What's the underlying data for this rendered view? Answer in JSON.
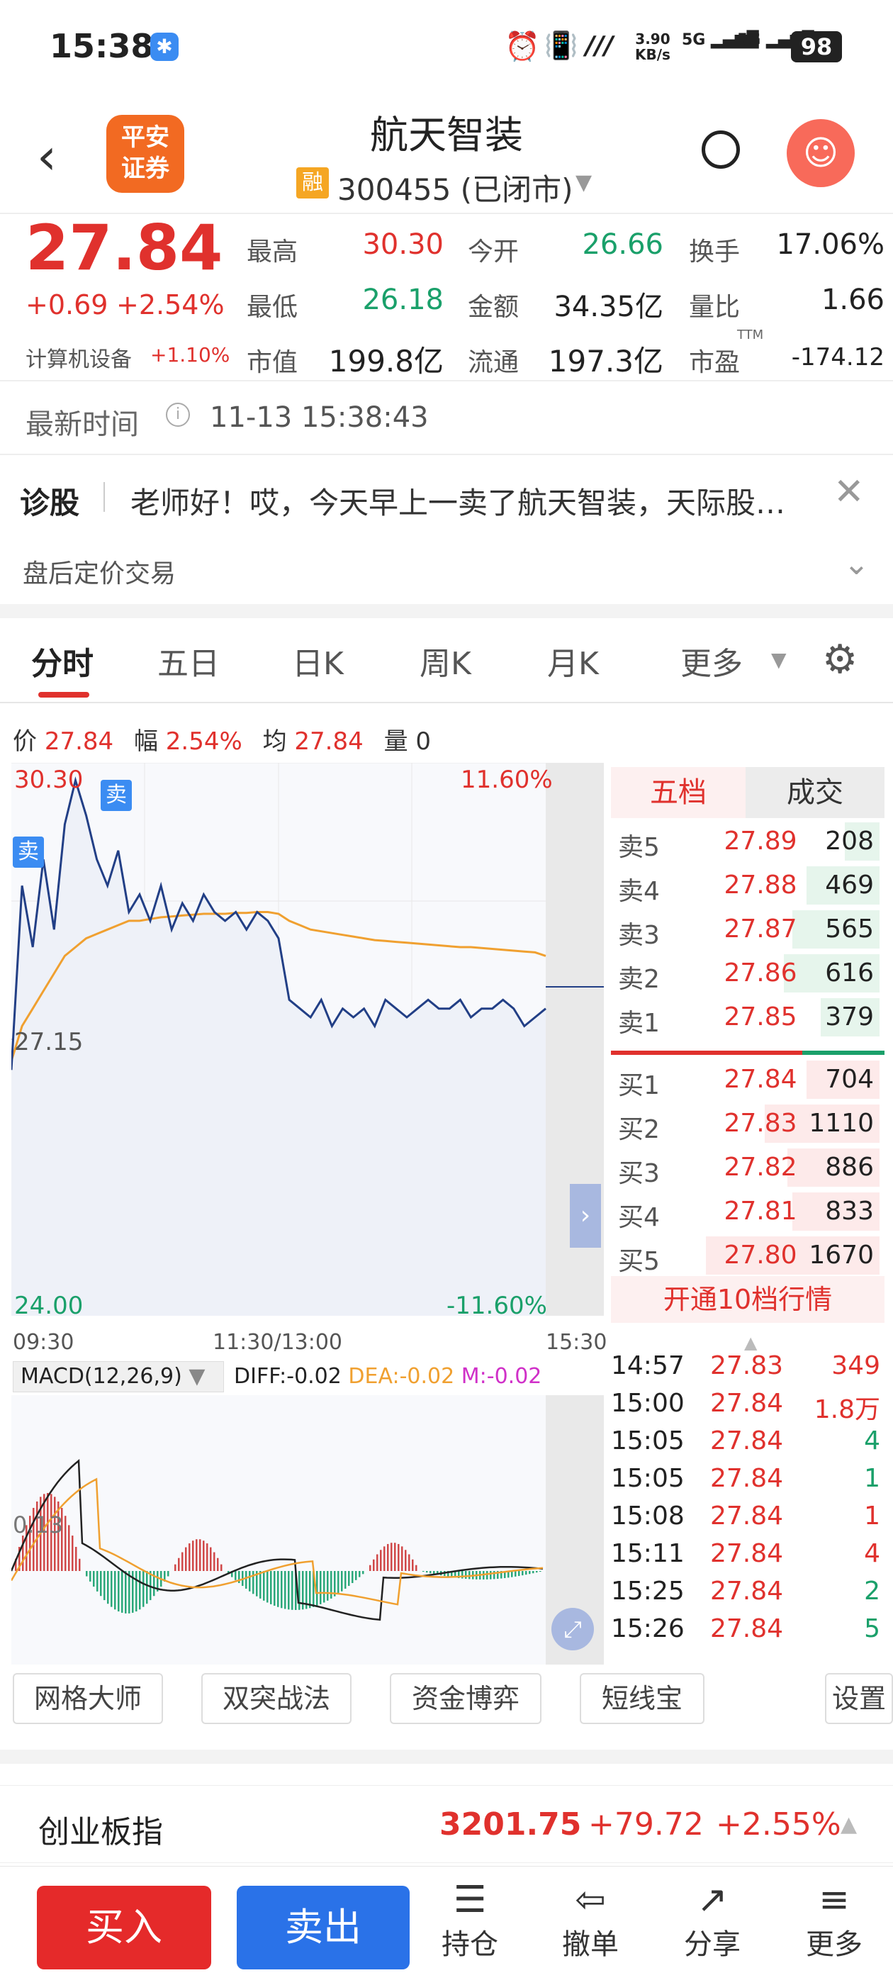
{
  "status_bar": {
    "time": "15:38",
    "net_speed_top": "3.90",
    "net_speed_bottom": "KB/s",
    "sig1": "5G",
    "sig2": "5G",
    "battery": "98"
  },
  "header": {
    "stock_name": "航天智装",
    "margin_badge": "融",
    "code_status": "300455 (已闭市)",
    "broker_logo": "平安\n证券"
  },
  "quote": {
    "price": "27.84",
    "change": "+0.69",
    "change_pct": "+2.54%",
    "industry": "计算机设备",
    "industry_pct": "+1.10%",
    "high_label": "最高",
    "high": "30.30",
    "open_label": "今开",
    "open": "26.66",
    "turnover_label": "换手",
    "turnover": "17.06%",
    "low_label": "最低",
    "low": "26.18",
    "amount_label": "金额",
    "amount": "34.35亿",
    "vol_ratio_label": "量比",
    "vol_ratio": "1.66",
    "mktcap_label": "市值",
    "mktcap": "199.8亿",
    "float_label": "流通",
    "float": "197.3亿",
    "pe_label": "市盈",
    "pe_sup": "TTM",
    "pe": "-174.12"
  },
  "latest_time": {
    "label": "最新时间",
    "value": "11-13 15:38:43"
  },
  "diagnose": {
    "label": "诊股",
    "text": "老师好！哎，今天早上一卖了航天智装，天际股…"
  },
  "after_hours": {
    "label": "盘后定价交易"
  },
  "tabs": [
    "分时",
    "五日",
    "日K",
    "周K",
    "月K",
    "更多"
  ],
  "info_line": {
    "price_label": "价",
    "price": "27.84",
    "amp_label": "幅",
    "amp": "2.54%",
    "avg_label": "均",
    "avg": "27.84",
    "vol_label": "量",
    "vol": "0"
  },
  "chart_labels": {
    "top_left": "30.30",
    "top_right": "11.60%",
    "mid": "27.15",
    "bottom_left": "24.00",
    "bottom_right": "-11.60%",
    "t_start": "09:30",
    "t_mid": "11:30/13:00",
    "t_end": "15:30",
    "sell_tag": "卖",
    "macd_mid": "0.13"
  },
  "macd": {
    "label": "MACD(12,26,9)",
    "diff": "DIFF:-0.02",
    "dea": "DEA:-0.02",
    "m": "M:-0.02"
  },
  "orderbook_tabs": {
    "active": "五档",
    "inactive": "成交"
  },
  "asks": [
    {
      "label": "卖5",
      "price": "27.89",
      "vol": "208",
      "bar": 0.2
    },
    {
      "label": "卖4",
      "price": "27.88",
      "vol": "469",
      "bar": 0.42
    },
    {
      "label": "卖3",
      "price": "27.87",
      "vol": "565",
      "bar": 0.5
    },
    {
      "label": "卖2",
      "price": "27.86",
      "vol": "616",
      "bar": 0.55
    },
    {
      "label": "卖1",
      "price": "27.85",
      "vol": "379",
      "bar": 0.34
    }
  ],
  "bids": [
    {
      "label": "买1",
      "price": "27.84",
      "vol": "704",
      "bar": 0.42
    },
    {
      "label": "买2",
      "price": "27.83",
      "vol": "1110",
      "bar": 0.66
    },
    {
      "label": "买3",
      "price": "27.82",
      "vol": "886",
      "bar": 0.53
    },
    {
      "label": "买4",
      "price": "27.81",
      "vol": "833",
      "bar": 0.5
    },
    {
      "label": "买5",
      "price": "27.80",
      "vol": "1670",
      "bar": 1.0
    }
  ],
  "open_l2": "开通10档行情",
  "trades": [
    {
      "time": "14:57",
      "price": "27.83",
      "vol": "349",
      "side": "buy"
    },
    {
      "time": "15:00",
      "price": "27.84",
      "vol": "1.8万",
      "side": "buy"
    },
    {
      "time": "15:05",
      "price": "27.84",
      "vol": "4",
      "side": "sell"
    },
    {
      "time": "15:05",
      "price": "27.84",
      "vol": "1",
      "side": "sell"
    },
    {
      "time": "15:08",
      "price": "27.84",
      "vol": "1",
      "side": "buy"
    },
    {
      "time": "15:11",
      "price": "27.84",
      "vol": "4",
      "side": "buy"
    },
    {
      "time": "15:25",
      "price": "27.84",
      "vol": "2",
      "side": "sell"
    },
    {
      "time": "15:26",
      "price": "27.84",
      "vol": "5",
      "side": "sell"
    }
  ],
  "tools": [
    "网格大师",
    "双突战法",
    "资金博弈",
    "短线宝",
    "设置"
  ],
  "index_bar": {
    "name": "创业板指",
    "value": "3201.75",
    "change": "+79.72",
    "pct": "+2.55%"
  },
  "bottom": {
    "buy": "买入",
    "sell": "卖出",
    "nav": [
      "持仓",
      "撤单",
      "分享",
      "更多"
    ]
  },
  "chart_data": {
    "type": "line",
    "ylim": [
      24.0,
      30.3
    ],
    "prev_close": 27.15,
    "series": [
      {
        "values": [
          26.8,
          28.9,
          28.2,
          29.2,
          28.4,
          29.6,
          30.1,
          29.7,
          29.2,
          28.9,
          29.3,
          28.6,
          28.8,
          28.5,
          28.9,
          28.4,
          28.7,
          28.5,
          28.8,
          28.6,
          28.5,
          28.6,
          28.4,
          28.6,
          28.5,
          28.3,
          27.6,
          27.5,
          27.4,
          27.6,
          27.3,
          27.5,
          27.4,
          27.5,
          27.3,
          27.6,
          27.5,
          27.4,
          27.5,
          27.6,
          27.5,
          27.5,
          27.6,
          27.4,
          27.5,
          27.5,
          27.6,
          27.5,
          27.3,
          27.4,
          27.5
        ]
      },
      {
        "values": [
          26.9,
          27.3,
          27.5,
          27.7,
          27.9,
          28.1,
          28.2,
          28.3,
          28.35,
          28.4,
          28.45,
          28.5,
          28.5,
          28.52,
          28.54,
          28.55,
          28.56,
          28.57,
          28.58,
          28.58,
          28.58,
          28.59,
          28.59,
          28.6,
          28.6,
          28.58,
          28.5,
          28.45,
          28.4,
          28.38,
          28.36,
          28.34,
          28.32,
          28.3,
          28.28,
          28.27,
          28.26,
          28.25,
          28.24,
          28.23,
          28.22,
          28.21,
          28.2,
          28.2,
          28.19,
          28.18,
          28.17,
          28.16,
          28.15,
          28.14,
          28.1
        ]
      }
    ]
  }
}
